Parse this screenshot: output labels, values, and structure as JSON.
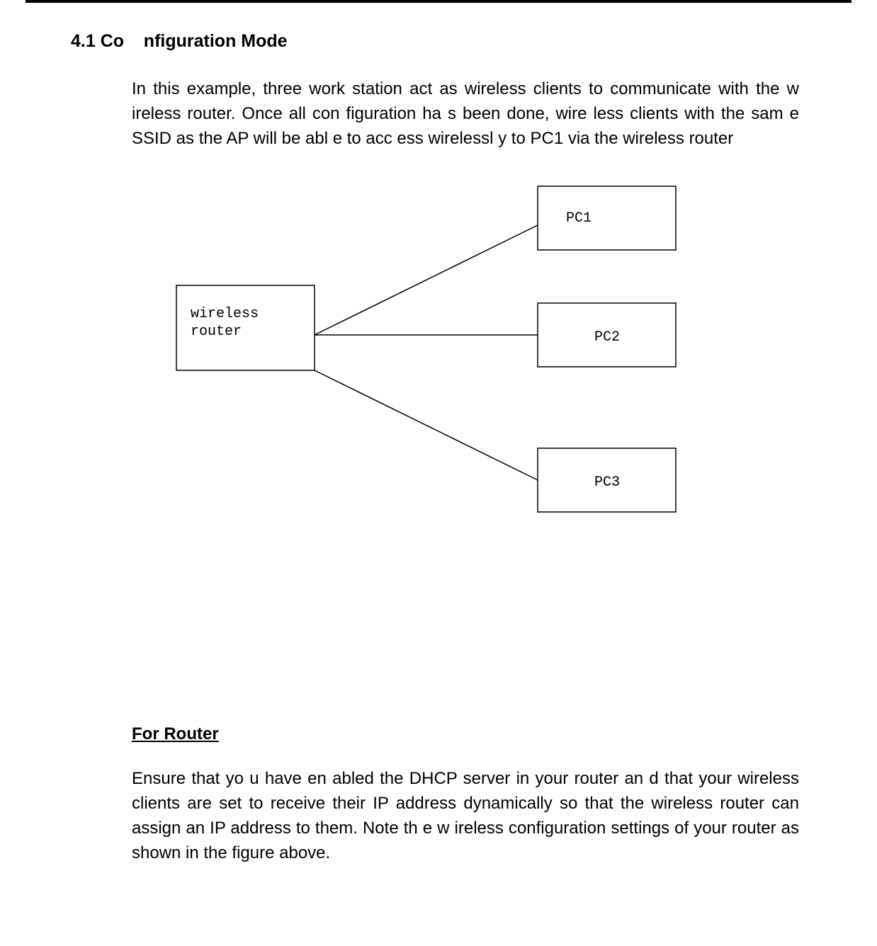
{
  "heading": "4.1 Co    nfiguration Mode",
  "intro_paragraph": "In this example, three work station act as wireless clients to communicate with the w ireless router.  Once all con  figuration ha s been done,  wire less clients with the sam e SSID as the AP   will be abl e to acc ess wirelessl y to PC1 via the wireless router",
  "diagram": {
    "router_label_line1": "wireless",
    "router_label_line2": "router",
    "pc1_label": "PC1",
    "pc2_label": "PC2",
    "pc3_label": "PC3"
  },
  "subheading": "For  Router",
  "router_paragraph": "Ensure that yo u have en abled the DHCP  server in   your router an d that your wireless clients are set to receive their IP address dynamically so that the wireless router can assign an IP address to them.   Note th e w ireless configuration settings of your router as shown in the figure above."
}
